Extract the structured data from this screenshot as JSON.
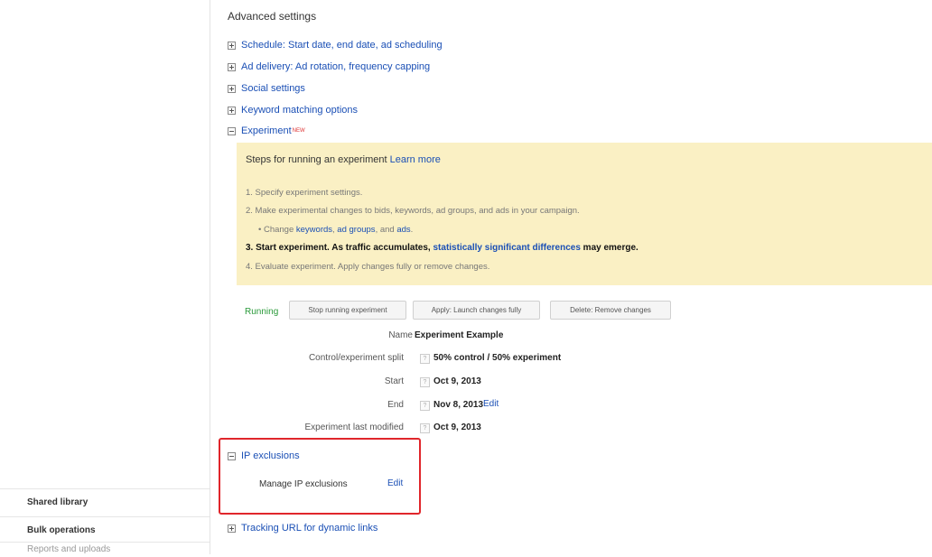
{
  "sidebar": {
    "items": [
      {
        "label": "Shared library"
      },
      {
        "label": "Bulk operations"
      },
      {
        "label": "Reports and uploads"
      }
    ]
  },
  "main": {
    "heading": "Advanced settings",
    "sections": [
      {
        "label": "Schedule: Start date, end date, ad scheduling",
        "state": "collapsed"
      },
      {
        "label": "Ad delivery: Ad rotation, frequency capping",
        "state": "collapsed"
      },
      {
        "label": "Social settings",
        "state": "collapsed"
      },
      {
        "label": "Keyword matching options",
        "state": "collapsed"
      },
      {
        "label": "Experiment",
        "badge": "NEW",
        "state": "expanded"
      }
    ],
    "experiment_panel": {
      "title": "Steps for running an experiment",
      "learn_more": "Learn more",
      "step1": "1. Specify experiment settings.",
      "step2": "2. Make experimental changes to bids, keywords, ad groups, and ads in your campaign.",
      "substep_prefix": "• Change",
      "substep_link1": "keywords",
      "substep_sep1": ",",
      "substep_link2": "ad groups",
      "substep_sep2": ", and",
      "substep_link3": "ads",
      "substep_end": ".",
      "step3_text": "3. Start experiment. As traffic accumulates,",
      "step3_link": "statistically significant differences",
      "step3_end": "may emerge.",
      "step4": "4. Evaluate experiment. Apply changes fully or remove changes."
    },
    "status": "Running",
    "buttons": {
      "stop": "Stop running experiment",
      "apply": "Apply: Launch changes fully",
      "delete": "Delete: Remove changes"
    },
    "details": {
      "name_label": "Name",
      "name_value": "Experiment Example",
      "split_label": "Control/experiment split",
      "split_value": "50% control / 50% experiment",
      "start_label": "Start",
      "start_value": "Oct 9, 2013",
      "end_label": "End",
      "end_value": "Nov 8, 2013",
      "end_edit": "Edit",
      "modified_label": "Experiment last modified",
      "modified_value": "Oct 9, 2013",
      "help_glyph": "?"
    },
    "ip_exclusions": {
      "title": "IP exclusions",
      "manage_label": "Manage IP exclusions",
      "edit": "Edit"
    },
    "tracking": {
      "label": "Tracking URL for dynamic links"
    },
    "colors": {
      "link": "#1a4fb5",
      "panel_bg": "#faf0c4",
      "running": "#2a9a3a",
      "highlight": "#e0262b"
    }
  }
}
